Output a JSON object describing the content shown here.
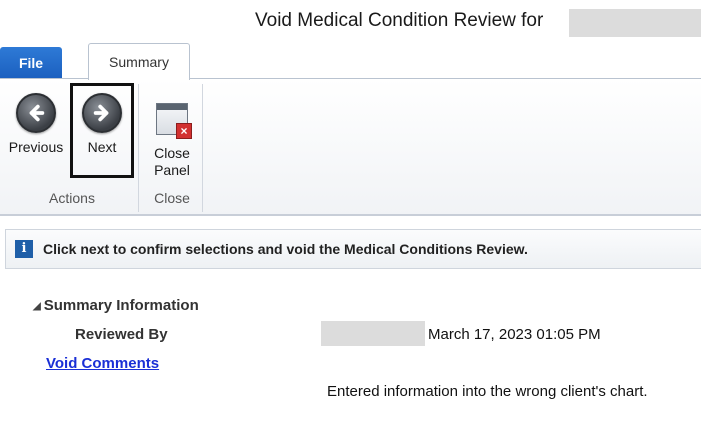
{
  "window": {
    "title": "Void Medical Condition Review for"
  },
  "tabs": {
    "file": "File",
    "summary": "Summary"
  },
  "ribbon": {
    "previous": "Previous",
    "next": "Next",
    "close_panel_line1": "Close",
    "close_panel_line2": "Panel",
    "group_actions": "Actions",
    "group_close": "Close"
  },
  "info": {
    "message": "Click next to confirm selections and void the Medical Conditions Review."
  },
  "summary": {
    "section_title": "Summary Information",
    "reviewed_by_label": "Reviewed By",
    "reviewed_by_value": "March 17, 2023 01:05 PM",
    "void_comments_link": "Void Comments",
    "comment_text": "Entered information into the wrong client's chart."
  },
  "colors": {
    "file_tab": "#1b5fbf",
    "link": "#1a2fd6",
    "info_icon": "#1f5fa8",
    "close_x": "#d23030"
  }
}
